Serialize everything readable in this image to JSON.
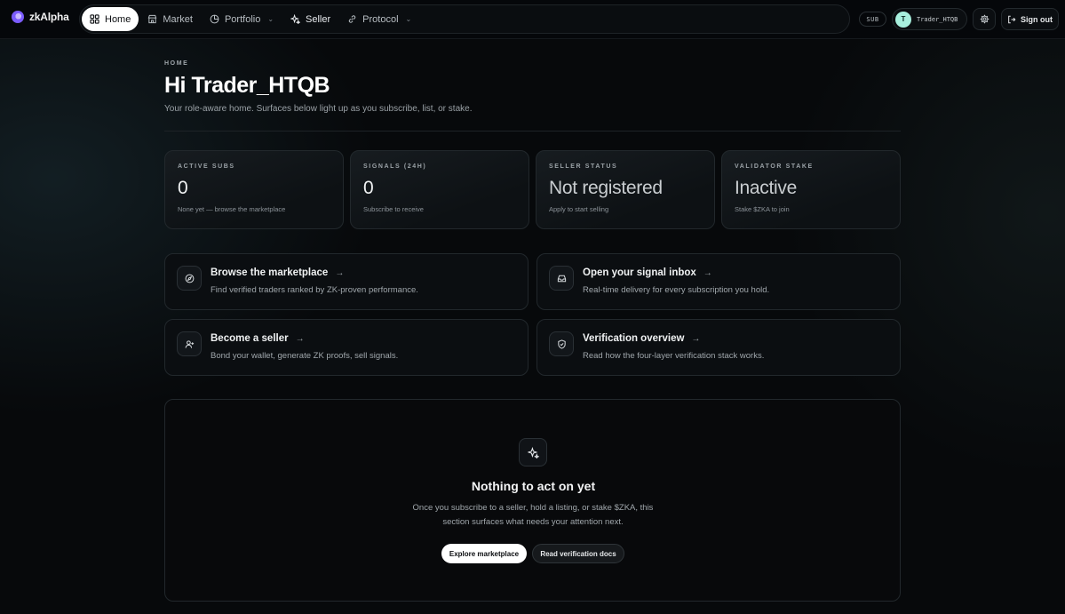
{
  "brand": {
    "name": "zkAlpha"
  },
  "nav": {
    "items": [
      {
        "label": "Home",
        "icon": "grid-icon",
        "active": true
      },
      {
        "label": "Market",
        "icon": "store-icon"
      },
      {
        "label": "Portfolio",
        "icon": "pie-chart-icon",
        "dropdown": true
      },
      {
        "label": "Seller",
        "icon": "sparkles-icon"
      },
      {
        "label": "Protocol",
        "icon": "link-icon",
        "dropdown": true
      }
    ]
  },
  "account": {
    "badge": "SUB",
    "avatar_initial": "T",
    "username": "Trader_HTQB",
    "signout_label": "Sign out"
  },
  "header": {
    "eyebrow": "HOME",
    "greeting": "Hi Trader_HTQB",
    "subtitle": "Your role-aware home. Surfaces below light up as you subscribe, list, or stake."
  },
  "stats": [
    {
      "label": "ACTIVE SUBS",
      "value": "0",
      "note": "None yet — browse the marketplace"
    },
    {
      "label": "SIGNALS (24H)",
      "value": "0",
      "note": "Subscribe to receive"
    },
    {
      "label": "SELLER STATUS",
      "value": "Not registered",
      "note": "Apply to start selling"
    },
    {
      "label": "VALIDATOR STAKE",
      "value": "Inactive",
      "note": "Stake $ZKA to join"
    }
  ],
  "actions": [
    {
      "title": "Browse the marketplace",
      "desc": "Find verified traders ranked by ZK-proven performance.",
      "icon": "compass-icon"
    },
    {
      "title": "Open your signal inbox",
      "desc": "Real-time delivery for every subscription you hold.",
      "icon": "inbox-icon"
    },
    {
      "title": "Become a seller",
      "desc": "Bond your wallet, generate ZK proofs, sell signals.",
      "icon": "user-plus-icon"
    },
    {
      "title": "Verification overview",
      "desc": "Read how the four-layer verification stack works.",
      "icon": "shield-check-icon"
    }
  ],
  "empty_state": {
    "title": "Nothing to act on yet",
    "desc": "Once you subscribe to a seller, hold a listing, or stake $ZKA, this section surfaces what needs your attention next.",
    "primary_label": "Explore marketplace",
    "secondary_label": "Read verification docs"
  },
  "colors": {
    "accent": "#7b5cff",
    "avatar": "#a8f0de",
    "background": "#07090b"
  }
}
